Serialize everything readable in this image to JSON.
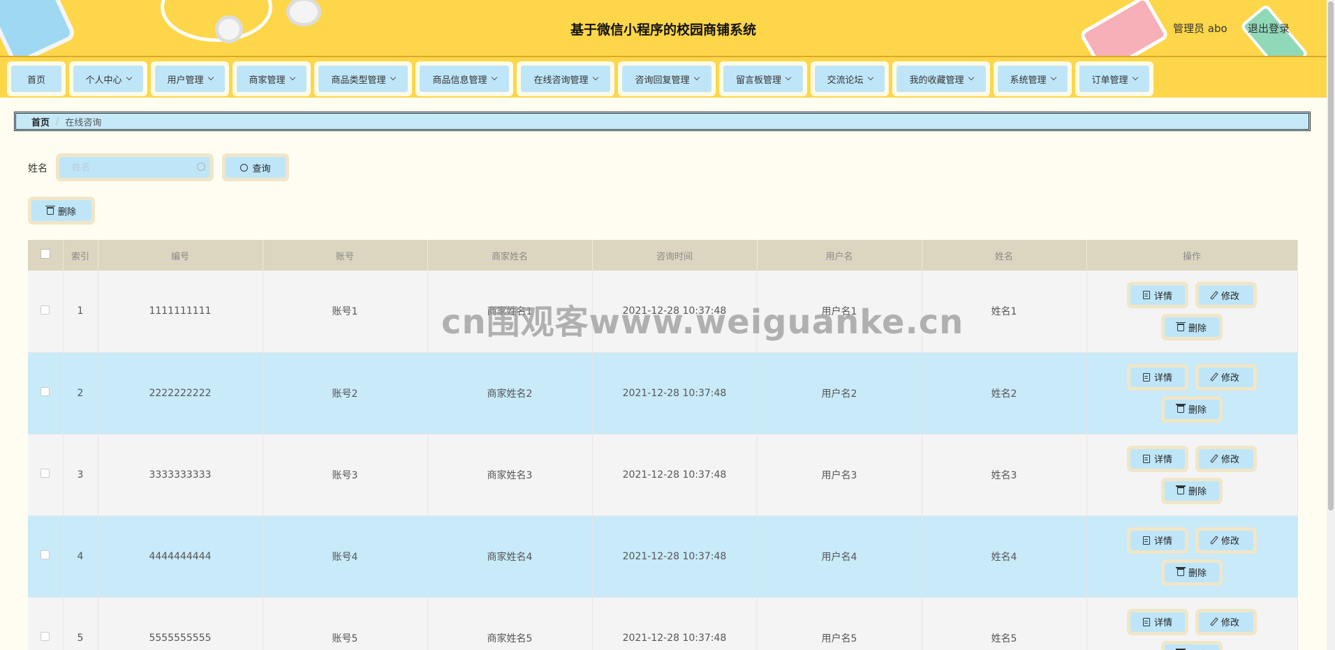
{
  "header": {
    "title": "基于微信小程序的校园商铺系统",
    "user": "管理员 abo",
    "logout": "退出登录"
  },
  "nav": [
    {
      "label": "首页",
      "dropdown": false
    },
    {
      "label": "个人中心",
      "dropdown": true
    },
    {
      "label": "用户管理",
      "dropdown": true
    },
    {
      "label": "商家管理",
      "dropdown": true
    },
    {
      "label": "商品类型管理",
      "dropdown": true
    },
    {
      "label": "商品信息管理",
      "dropdown": true
    },
    {
      "label": "在线咨询管理",
      "dropdown": true
    },
    {
      "label": "咨询回复管理",
      "dropdown": true
    },
    {
      "label": "留言板管理",
      "dropdown": true
    },
    {
      "label": "交流论坛",
      "dropdown": true
    },
    {
      "label": "我的收藏管理",
      "dropdown": true
    },
    {
      "label": "系统管理",
      "dropdown": true
    },
    {
      "label": "订单管理",
      "dropdown": true
    }
  ],
  "breadcrumb": {
    "home": "首页",
    "separator": "/",
    "current": "在线咨询"
  },
  "search": {
    "label": "姓名",
    "placeholder": "姓名",
    "button": "查询"
  },
  "toolbar": {
    "delete_label": "删除"
  },
  "table": {
    "columns": [
      "索引",
      "编号",
      "账号",
      "商家姓名",
      "咨询时间",
      "用户名",
      "姓名",
      "操作"
    ],
    "rows": [
      {
        "index": "1",
        "number": "1111111111",
        "account": "账号1",
        "merchant": "商家姓名1",
        "time": "2021-12-28 10:37:48",
        "username": "用户名1",
        "name": "姓名1"
      },
      {
        "index": "2",
        "number": "2222222222",
        "account": "账号2",
        "merchant": "商家姓名2",
        "time": "2021-12-28 10:37:48",
        "username": "用户名2",
        "name": "姓名2"
      },
      {
        "index": "3",
        "number": "3333333333",
        "account": "账号3",
        "merchant": "商家姓名3",
        "time": "2021-12-28 10:37:48",
        "username": "用户名3",
        "name": "姓名3"
      },
      {
        "index": "4",
        "number": "4444444444",
        "account": "账号4",
        "merchant": "商家姓名4",
        "time": "2021-12-28 10:37:48",
        "username": "用户名4",
        "name": "姓名4"
      },
      {
        "index": "5",
        "number": "5555555555",
        "account": "账号5",
        "merchant": "商家姓名5",
        "time": "2021-12-28 10:37:48",
        "username": "用户名5",
        "name": "姓名5"
      }
    ],
    "actions": {
      "detail": "详情",
      "edit": "修改",
      "delete": "删除"
    }
  },
  "watermark": "cn围观客www.weiguanke.cn",
  "colors": {
    "header_bg": "#fdd64a",
    "button_bg": "#bfe6f8",
    "button_border": "#f0e6c8",
    "row_alt": "#c8eaf9",
    "page_bg": "#fffdf2"
  }
}
